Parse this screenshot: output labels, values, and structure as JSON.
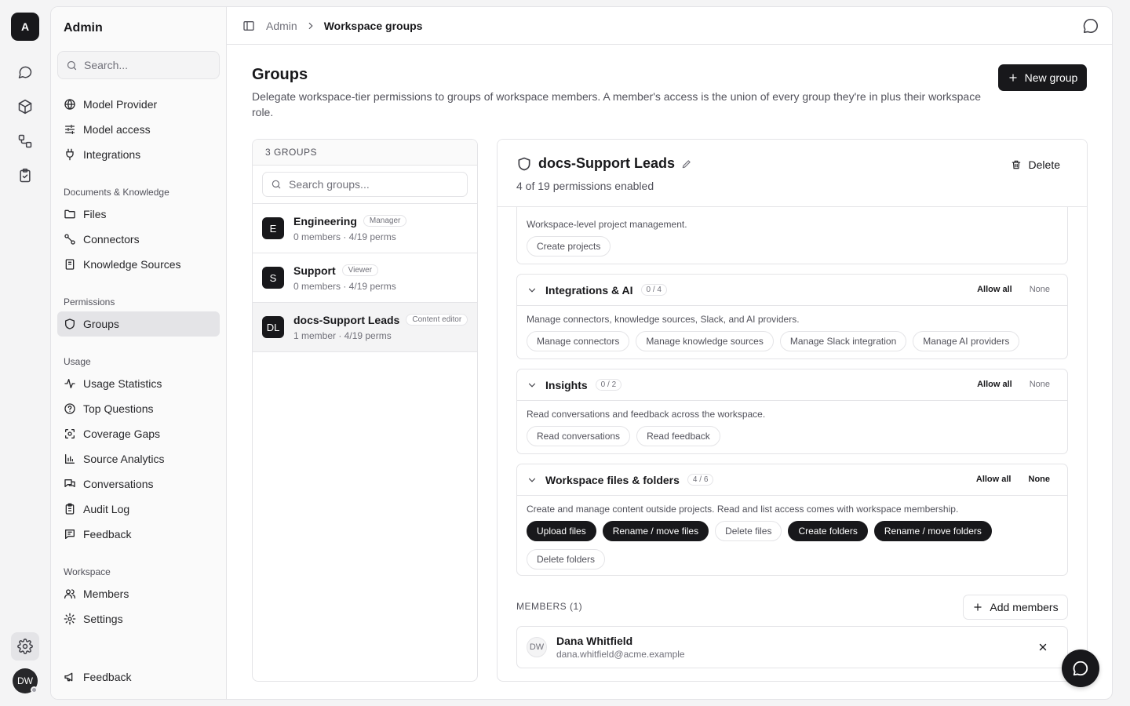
{
  "rail": {
    "logo": "A",
    "avatar": "DW"
  },
  "sidebar": {
    "title": "Admin",
    "search_placeholder": "Search...",
    "top_items": [
      {
        "label": "Model Provider",
        "icon": "globe-icon"
      },
      {
        "label": "Model access",
        "icon": "sliders-icon"
      },
      {
        "label": "Integrations",
        "icon": "plug-icon"
      }
    ],
    "sections": [
      {
        "title": "Documents & Knowledge",
        "items": [
          {
            "label": "Files",
            "icon": "folder-icon"
          },
          {
            "label": "Connectors",
            "icon": "connector-icon"
          },
          {
            "label": "Knowledge Sources",
            "icon": "book-icon"
          }
        ]
      },
      {
        "title": "Permissions",
        "items": [
          {
            "label": "Groups",
            "icon": "shield-icon",
            "active": true
          }
        ]
      },
      {
        "title": "Usage",
        "items": [
          {
            "label": "Usage Statistics",
            "icon": "activity-icon"
          },
          {
            "label": "Top Questions",
            "icon": "help-circle-icon"
          },
          {
            "label": "Coverage Gaps",
            "icon": "scan-icon"
          },
          {
            "label": "Source Analytics",
            "icon": "bar-chart-icon"
          },
          {
            "label": "Conversations",
            "icon": "messages-icon"
          },
          {
            "label": "Audit Log",
            "icon": "clipboard-icon"
          },
          {
            "label": "Feedback",
            "icon": "message-text-icon"
          }
        ]
      },
      {
        "title": "Workspace",
        "items": [
          {
            "label": "Members",
            "icon": "users-icon"
          },
          {
            "label": "Settings",
            "icon": "gear-icon"
          }
        ]
      }
    ],
    "footer_item": "Feedback"
  },
  "topbar": {
    "crumb_root": "Admin",
    "crumb_current": "Workspace groups"
  },
  "page": {
    "title": "Groups",
    "description": "Delegate workspace-tier permissions to groups of workspace members. A member's access is the union of every group they're in plus their workspace role.",
    "new_button": "New group"
  },
  "groups": {
    "header": "3 GROUPS",
    "search_placeholder": "Search groups...",
    "items": [
      {
        "initials": "E",
        "name": "Engineering",
        "badge": "Manager",
        "meta": "0 members · 4/19 perms"
      },
      {
        "initials": "S",
        "name": "Support",
        "badge": "Viewer",
        "meta": "0 members · 4/19 perms"
      },
      {
        "initials": "DL",
        "name": "docs-Support Leads",
        "badge": "Content editor",
        "meta": "1 member · 4/19 perms",
        "active": true
      }
    ]
  },
  "detail": {
    "name": "docs-Support Leads",
    "subtitle": "4 of 19 permissions enabled",
    "delete_label": "Delete",
    "partial_card": {
      "description": "Workspace-level project management.",
      "chips": [
        {
          "label": "Create projects",
          "on": false
        }
      ]
    },
    "cards": [
      {
        "title": "Integrations & AI",
        "count": "0 / 4",
        "allow": "Allow all",
        "none": "None",
        "description": "Manage connectors, knowledge sources, Slack, and AI providers.",
        "chips": [
          {
            "label": "Manage connectors",
            "on": false
          },
          {
            "label": "Manage knowledge sources",
            "on": false
          },
          {
            "label": "Manage Slack integration",
            "on": false
          },
          {
            "label": "Manage AI providers",
            "on": false
          }
        ]
      },
      {
        "title": "Insights",
        "count": "0 / 2",
        "allow": "Allow all",
        "none": "None",
        "description": "Read conversations and feedback across the workspace.",
        "chips": [
          {
            "label": "Read conversations",
            "on": false
          },
          {
            "label": "Read feedback",
            "on": false
          }
        ]
      },
      {
        "title": "Workspace files & folders",
        "count": "4 / 6",
        "allow": "Allow all",
        "none": "None",
        "description": "Create and manage content outside projects. Read and list access comes with workspace membership.",
        "chips": [
          {
            "label": "Upload files",
            "on": true
          },
          {
            "label": "Rename / move files",
            "on": true
          },
          {
            "label": "Delete files",
            "on": false
          },
          {
            "label": "Create folders",
            "on": true
          },
          {
            "label": "Rename / move folders",
            "on": true
          },
          {
            "label": "Delete folders",
            "on": false
          }
        ]
      }
    ],
    "members_label": "MEMBERS (1)",
    "add_members": "Add members",
    "members": [
      {
        "initials": "DW",
        "name": "Dana Whitfield",
        "email": "dana.whitfield@acme.example"
      }
    ]
  },
  "colors": {
    "accent": "#18181b",
    "muted": "#71717a",
    "border": "#e4e4e7"
  }
}
